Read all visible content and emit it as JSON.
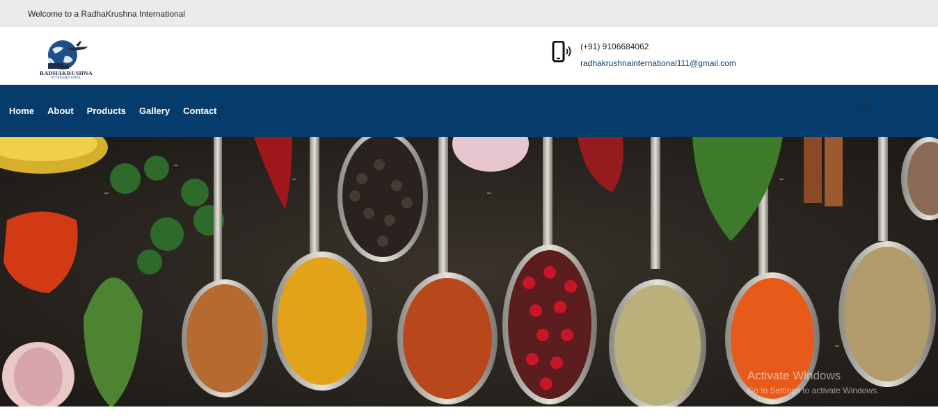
{
  "topbar": {
    "welcome": "Welcome to a RadhaKrushna International"
  },
  "header": {
    "logo": {
      "wordmark": "RADHAKRUSHNA",
      "sub": "INTERNATIONAL"
    },
    "phone": "(+91) 9106684062",
    "email": "radhakrushnainternational111@gmail.com"
  },
  "nav": {
    "items": [
      "Home",
      "About",
      "Products",
      "Gallery",
      "Contact"
    ]
  },
  "watermark": {
    "line1": "Activate Windows",
    "line2": "Go to Settings to activate Windows."
  },
  "colors": {
    "topbar_bg": "#ebebeb",
    "nav_bg": "#063c6c",
    "email_color": "#0b3d6b"
  },
  "icons": [
    "phone-icon",
    "search-icon"
  ]
}
